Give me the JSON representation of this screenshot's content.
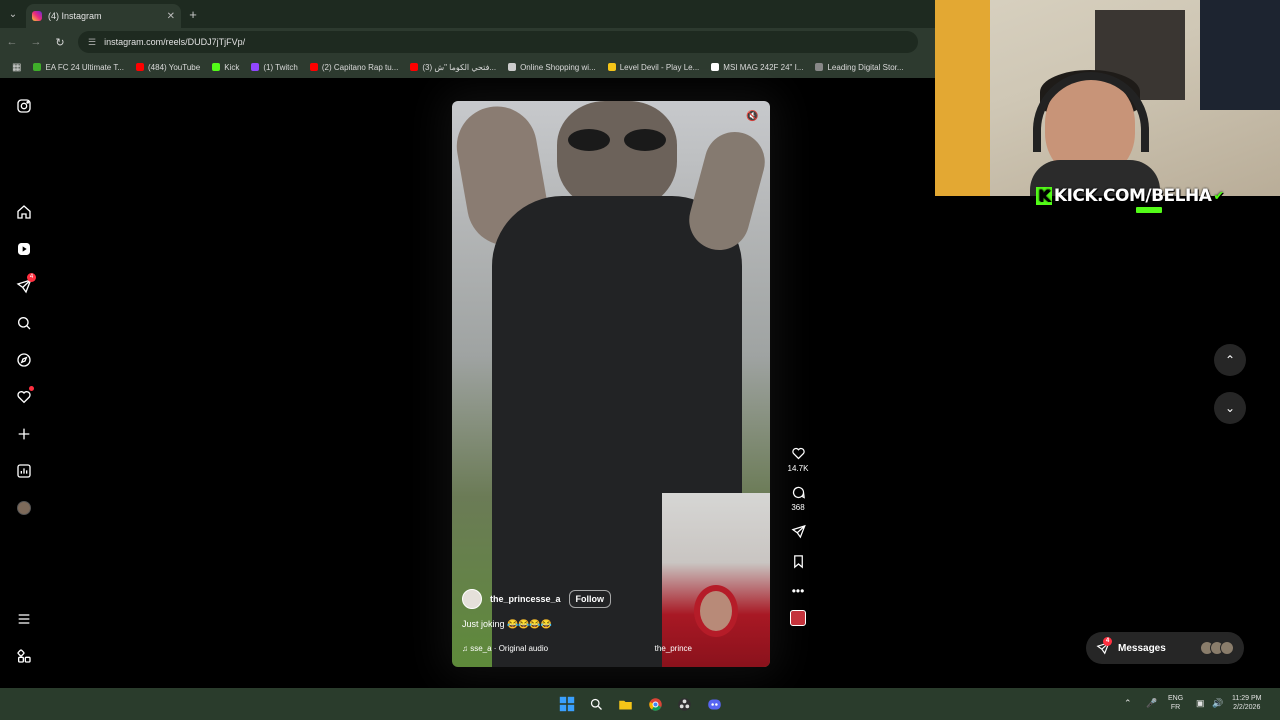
{
  "browser": {
    "tab_title": "(4) Instagram",
    "url": "instagram.com/reels/DUDJ7jTjFVp/",
    "new_tab_glyph": "+",
    "bookmarks": [
      {
        "label": "EA FC 24 Ultimate T...",
        "color": "#3fae2a"
      },
      {
        "label": "(484) YouTube",
        "color": "#ff0000"
      },
      {
        "label": "Kick",
        "color": "#53fc18"
      },
      {
        "label": "(1) Twitch",
        "color": "#9146ff"
      },
      {
        "label": "(2) Capitano Rap tu...",
        "color": "#ff0000"
      },
      {
        "label": "(3) فتحي الكوما \"ش...",
        "color": "#ff0000"
      },
      {
        "label": "Online Shopping wi...",
        "color": "#cccccc"
      },
      {
        "label": "Level Devil - Play Le...",
        "color": "#f5c518"
      },
      {
        "label": "MSI MAG 242F 24\" I...",
        "color": "#ffffff"
      },
      {
        "label": "Leading Digital Stor...",
        "color": "#888888"
      }
    ]
  },
  "sidebar": {
    "notifications_badge": "4"
  },
  "reel": {
    "author": "the_princesse_a",
    "follow_label": "Follow",
    "caption": "Just joking 😂😂😂😂",
    "audio": "sse_a · Original audio",
    "pip_author": "the_prince",
    "likes": "14.7K",
    "comments": "368"
  },
  "messages": {
    "label": "Messages",
    "badge": "4"
  },
  "overlay": {
    "kick_k": "K",
    "kick_text": "KICK.COM/BELHA"
  },
  "taskbar": {
    "lang_top": "ENG",
    "lang_bottom": "FR",
    "time": "11:29 PM",
    "date": "2/2/2026"
  },
  "colors": {
    "accent_red": "#ff3040",
    "kick_green": "#53fc18",
    "chrome_bg": "#2d3a2f"
  }
}
